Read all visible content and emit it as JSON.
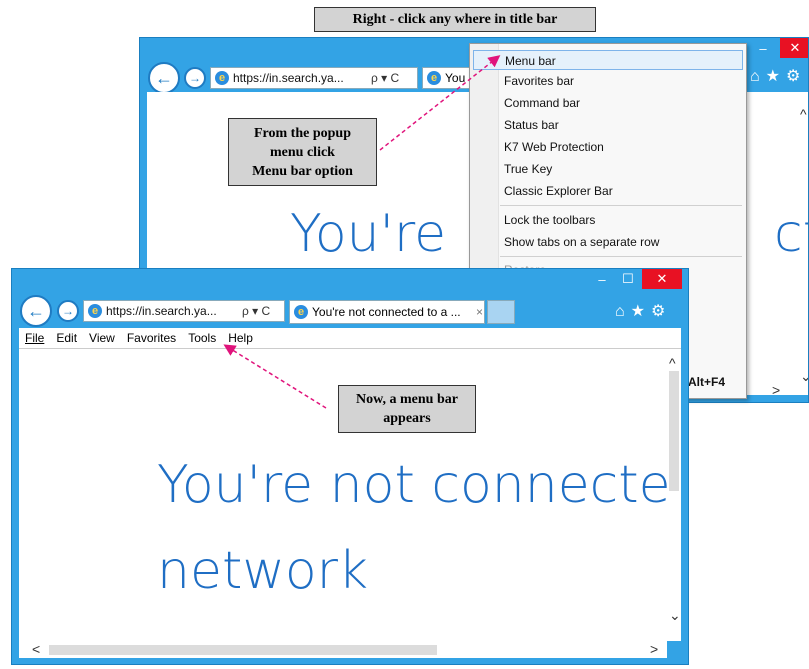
{
  "banner": "Right - click any where in title bar",
  "back_window": {
    "address": "https://in.search.ya...",
    "search_controls": "ρ ▾ C",
    "tab_label": "You",
    "page_text_left": "You're",
    "page_text_right": "cte",
    "minimize": "–",
    "close": "✕",
    "scroll_right": ">",
    "scroll_down": "⌄",
    "scroll_up": "^"
  },
  "popup_menu": {
    "items": [
      {
        "label": "Menu bar"
      },
      {
        "label": "Favorites bar"
      },
      {
        "label": "Command bar"
      },
      {
        "label": "Status bar"
      },
      {
        "label": "K7 Web Protection"
      },
      {
        "label": "True Key"
      },
      {
        "label": "Classic Explorer Bar"
      },
      {
        "label": "Lock the toolbars"
      },
      {
        "label": "Show tabs on a separate row"
      },
      {
        "label": "Restore"
      }
    ],
    "close_shortcut": "Alt+F4"
  },
  "front_window": {
    "address": "https://in.search.ya...",
    "search_controls": "ρ ▾ C",
    "tab_label": "You're not connected to a ...",
    "tab_close": "×",
    "menu": [
      "File",
      "Edit",
      "View",
      "Favorites",
      "Tools",
      "Help"
    ],
    "page_line1": "You're not connecte",
    "page_line2": "network",
    "minimize": "–",
    "maximize": "☐",
    "close": "✕",
    "scroll_left": "<",
    "scroll_right": ">",
    "scroll_up": "^",
    "scroll_down": "⌄"
  },
  "callouts": {
    "popup_hint": [
      "From the popup",
      "menu click",
      "Menu bar option"
    ],
    "menu_appears": [
      "Now, a menu bar",
      "appears"
    ]
  },
  "icons": [
    "back-arrow-icon",
    "forward-arrow-icon",
    "ie-logo-icon",
    "home-icon",
    "star-icon",
    "gear-icon"
  ],
  "colors": {
    "title_bar": "#33a3e5",
    "close": "#e81123",
    "page_text": "#1f6ec4",
    "arrow": "#e0147c"
  }
}
